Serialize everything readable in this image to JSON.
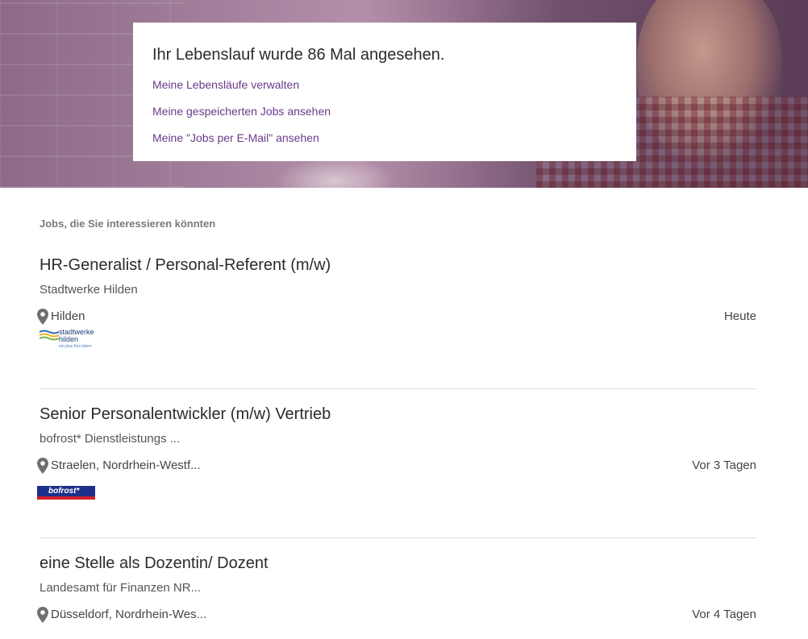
{
  "card": {
    "title": "Ihr Lebenslauf wurde 86 Mal angesehen.",
    "links": [
      "Meine Lebensläufe verwalten",
      "Meine gespeicherten Jobs ansehen",
      "Meine \"Jobs per E-Mail\" ansehen"
    ]
  },
  "section_title": "Jobs, die Sie interessieren könnten",
  "jobs": [
    {
      "title": "HR-Generalist / Personal-Referent (m/w)",
      "company": "Stadtwerke Hilden",
      "location": "Hilden",
      "date": "Heute",
      "logo": {
        "line1": "stadtwerke",
        "line2": "hilden",
        "line3": "ein plus fürs leben"
      }
    },
    {
      "title": "Senior Personalentwickler (m/w) Vertrieb",
      "company": "bofrost* Dienstleistungs ...",
      "location": "Straelen, Nordrhein-Westf...",
      "date": "Vor 3 Tagen",
      "logo": {
        "text": "bofrost*"
      }
    },
    {
      "title": "eine Stelle als Dozentin/ Dozent",
      "company": "Landesamt für Finanzen NR...",
      "location": "Düsseldorf, Nordrhein-Wes...",
      "date": "Vor 4 Tagen"
    }
  ],
  "icons": {
    "location": "map-pin-icon"
  },
  "colors": {
    "link": "#6b3a8a",
    "hero_overlay": "#8d6a88",
    "divider": "#dcdcdc"
  }
}
